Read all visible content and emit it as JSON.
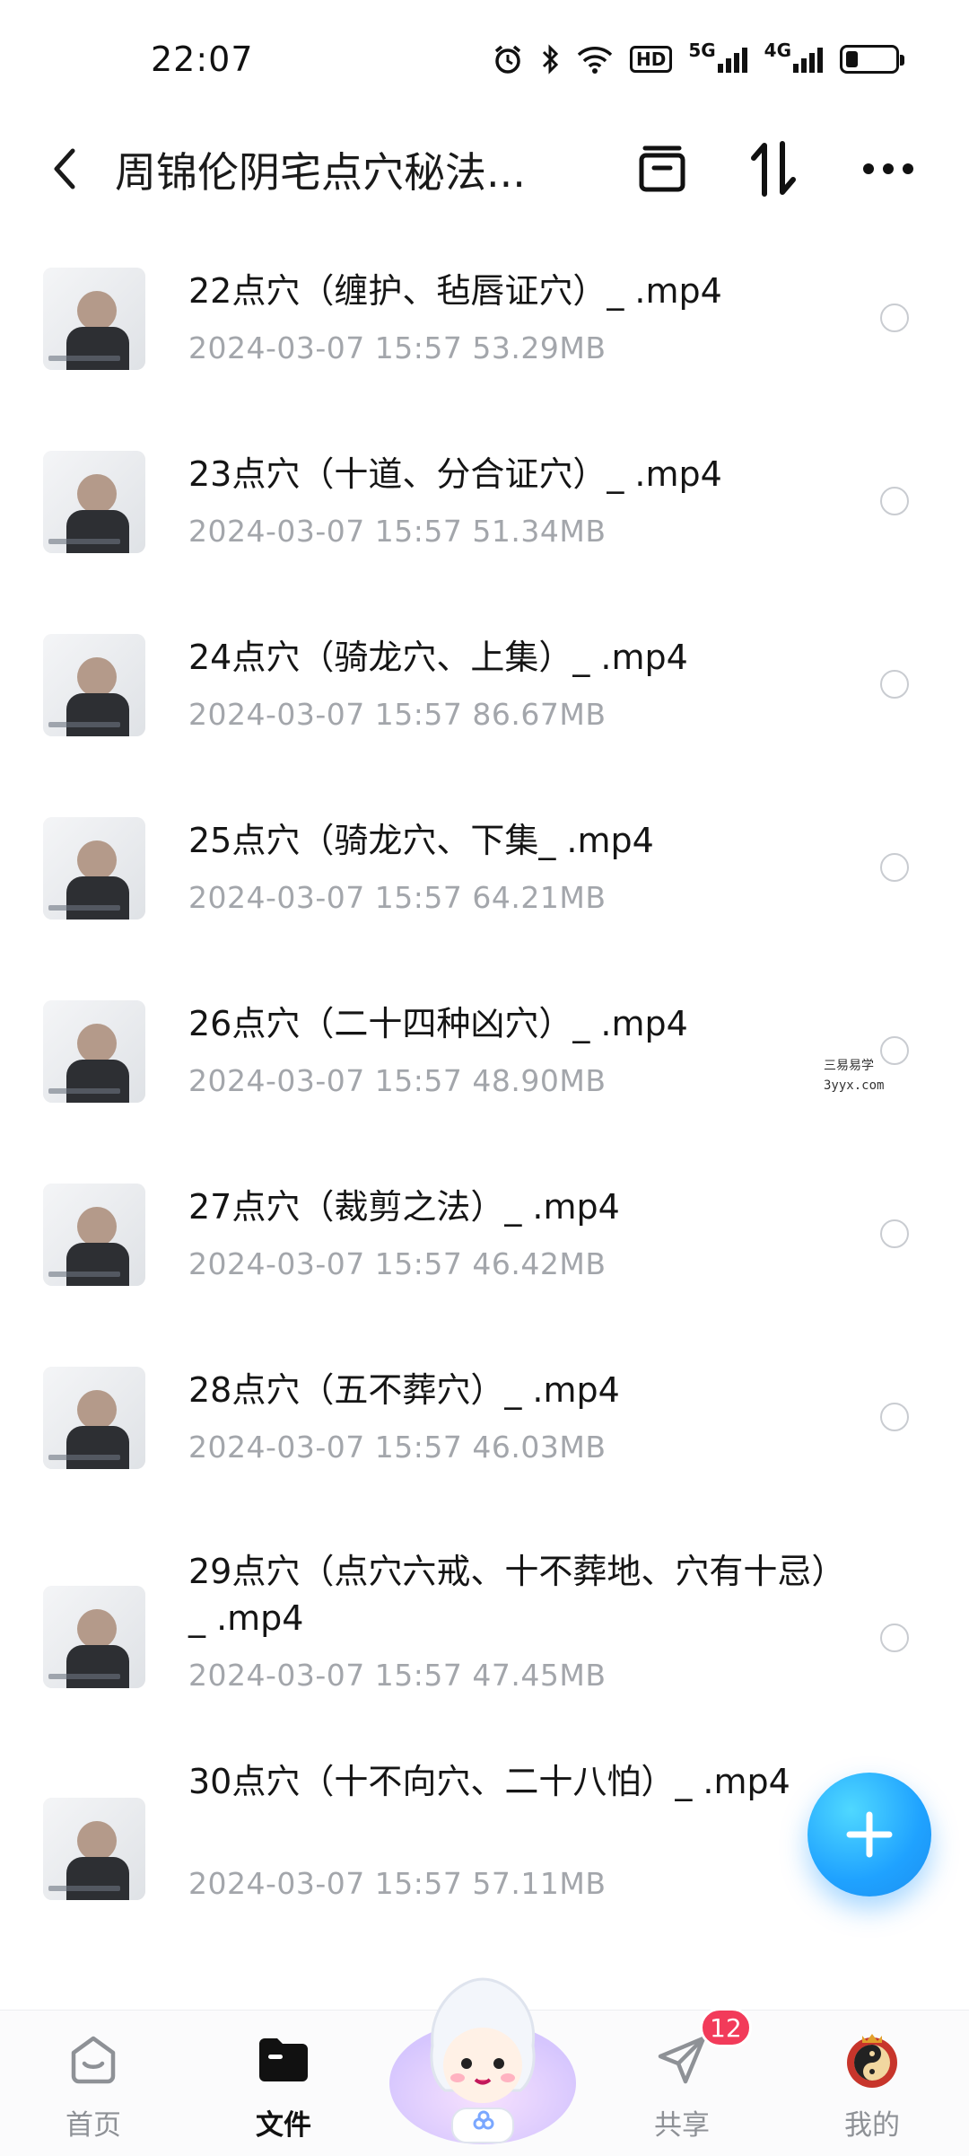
{
  "status_bar": {
    "time": "22:07",
    "icons": [
      "alarm-icon",
      "bluetooth-icon",
      "wifi-icon",
      "hd-icon",
      "signal-5g-icon",
      "signal-4g-icon",
      "battery-icon"
    ],
    "hd_text": "HD",
    "net1": "5G",
    "net2": "4G",
    "battery_level": 0.25
  },
  "header": {
    "title": "周锦伦阴宅点穴秘法...",
    "back_icon": "chevron-left-icon",
    "icons": [
      "select-icon",
      "sort-icon",
      "more-icon"
    ]
  },
  "files": [
    {
      "name": "22点穴（缠护、毡唇证穴）_ .mp4",
      "date": "2024-03-07",
      "time": "15:57",
      "size": "53.29MB"
    },
    {
      "name": "23点穴（十道、分合证穴）_ .mp4",
      "date": "2024-03-07",
      "time": "15:57",
      "size": "51.34MB"
    },
    {
      "name": "24点穴（骑龙穴、上集）_ .mp4",
      "date": "2024-03-07",
      "time": "15:57",
      "size": "86.67MB"
    },
    {
      "name": "25点穴（骑龙穴、下集_ .mp4",
      "date": "2024-03-07",
      "time": "15:57",
      "size": "64.21MB"
    },
    {
      "name": "26点穴（二十四种凶穴）_ .mp4",
      "date": "2024-03-07",
      "time": "15:57",
      "size": "48.90MB"
    },
    {
      "name": "27点穴（裁剪之法）_ .mp4",
      "date": "2024-03-07",
      "time": "15:57",
      "size": "46.42MB"
    },
    {
      "name": "28点穴（五不葬穴）_ .mp4",
      "date": "2024-03-07",
      "time": "15:57",
      "size": "46.03MB"
    },
    {
      "name": "29点穴（点穴六戒、十不葬地、穴有十忌）_ .mp4",
      "date": "2024-03-07",
      "time": "15:57",
      "size": "47.45MB"
    },
    {
      "name": "30点穴（十不向穴、二十八怕）_ .mp4",
      "date": "2024-03-07",
      "time": "15:57",
      "size": "57.11MB"
    }
  ],
  "watermark": {
    "line1": "三易易学",
    "line2": "3yyx.com"
  },
  "fab": {
    "icon": "plus-icon"
  },
  "bottom_nav": {
    "items": [
      {
        "label": "首页",
        "icon": "home-icon"
      },
      {
        "label": "文件",
        "icon": "folder-icon",
        "active": true
      },
      {
        "label": "共享",
        "icon": "send-icon"
      },
      {
        "label": "我的",
        "icon": "profile-avatar-icon"
      }
    ],
    "share_badge": "12",
    "center_icon": "assistant-mascot-icon"
  }
}
